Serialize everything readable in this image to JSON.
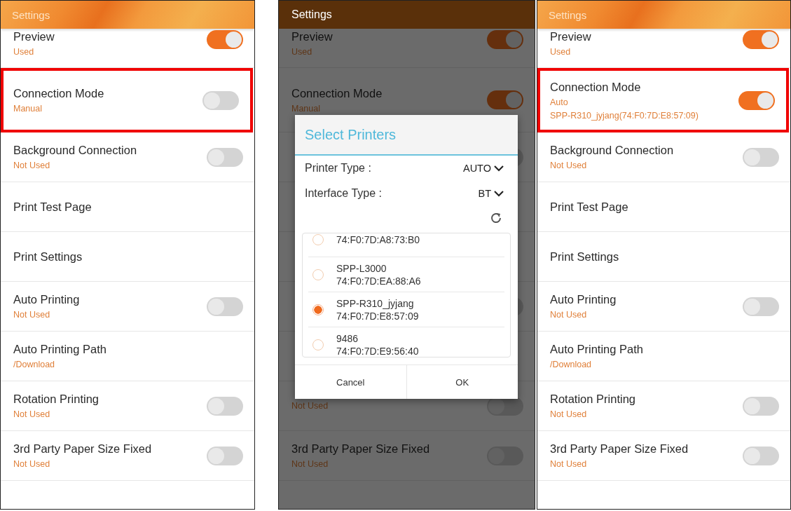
{
  "panels": [
    {
      "title": "Settings",
      "items": [
        {
          "title": "Preview",
          "subtitles": [
            "Used"
          ],
          "kind": "toggle",
          "on": true,
          "highlighted": false
        },
        {
          "title": "Connection Mode",
          "subtitles": [
            "Manual"
          ],
          "kind": "toggle",
          "on": false,
          "highlighted": true
        },
        {
          "title": "Background Connection",
          "subtitles": [
            "Not Used"
          ],
          "kind": "toggle",
          "on": false,
          "highlighted": false
        },
        {
          "title": "Print Test Page",
          "kind": "plain",
          "highlighted": false
        },
        {
          "title": "Print Settings",
          "kind": "plain",
          "highlighted": false
        },
        {
          "title": "Auto Printing",
          "subtitles": [
            "Not Used"
          ],
          "kind": "toggle",
          "on": false,
          "highlighted": false
        },
        {
          "title": "Auto Printing Path",
          "subtitles": [
            "/Download"
          ],
          "kind": "plain",
          "highlighted": false
        },
        {
          "title": "Rotation Printing",
          "subtitles": [
            "Not Used"
          ],
          "kind": "toggle",
          "on": false,
          "highlighted": false
        },
        {
          "title": "3rd Party Paper Size Fixed",
          "subtitles": [
            "Not Used"
          ],
          "kind": "toggle",
          "on": false,
          "highlighted": false
        }
      ]
    },
    {
      "title": "Settings",
      "items": [
        {
          "title": "Preview",
          "subtitles": [
            "Used"
          ],
          "kind": "toggle",
          "on": true,
          "highlighted": false
        },
        {
          "title": "Connection Mode",
          "subtitles": [
            "Manual"
          ],
          "kind": "toggle",
          "on": true,
          "highlighted": false
        },
        {
          "kind": "toggle",
          "on": false,
          "highlighted": false
        },
        {
          "kind": "plain",
          "highlighted": false
        },
        {
          "kind": "plain",
          "highlighted": false
        },
        {
          "kind": "toggle",
          "on": false,
          "highlighted": false
        },
        {
          "kind": "plain",
          "highlighted": false
        },
        {
          "subtitles": [
            "Not Used"
          ],
          "kind": "toggle",
          "on": false,
          "highlighted": false
        },
        {
          "title": "3rd Party Paper Size Fixed",
          "subtitles": [
            "Not Used"
          ],
          "kind": "toggle",
          "on": false,
          "highlighted": false
        }
      ],
      "dialog": {
        "title": "Select Printers",
        "fields": [
          {
            "label": "Printer Type :",
            "value": "AUTO"
          },
          {
            "label": "Interface Type :",
            "value": "BT"
          }
        ],
        "devices": [
          {
            "address": "74:F0:7D:A8:73:B0",
            "selected": false
          },
          {
            "name": "SPP-L3000",
            "address": "74:F0:7D:EA:88:A6",
            "selected": false
          },
          {
            "name": "SPP-R310_jyjang",
            "address": "74:F0:7D:E8:57:09",
            "selected": true
          },
          {
            "name": "9486",
            "address": "74:F0:7D:E9:56:40",
            "selected": false
          }
        ],
        "buttons": [
          "Cancel",
          "OK"
        ]
      }
    },
    {
      "title": "Settings",
      "items": [
        {
          "title": "Preview",
          "subtitles": [
            "Used"
          ],
          "kind": "toggle",
          "on": true,
          "highlighted": false
        },
        {
          "title": "Connection Mode",
          "subtitles": [
            "Auto",
            "SPP-R310_jyjang(74:F0:7D:E8:57:09)"
          ],
          "kind": "toggle",
          "on": true,
          "highlighted": true
        },
        {
          "title": "Background Connection",
          "subtitles": [
            "Not Used"
          ],
          "kind": "toggle",
          "on": false,
          "highlighted": false
        },
        {
          "title": "Print Test Page",
          "kind": "plain",
          "highlighted": false
        },
        {
          "title": "Print Settings",
          "kind": "plain",
          "highlighted": false
        },
        {
          "title": "Auto Printing",
          "subtitles": [
            "Not Used"
          ],
          "kind": "toggle",
          "on": false,
          "highlighted": false
        },
        {
          "title": "Auto Printing Path",
          "subtitles": [
            "/Download"
          ],
          "kind": "plain",
          "highlighted": false
        },
        {
          "title": "Rotation Printing",
          "subtitles": [
            "Not Used"
          ],
          "kind": "toggle",
          "on": false,
          "highlighted": false
        },
        {
          "title": "3rd Party Paper Size Fixed",
          "subtitles": [
            "Not Used"
          ],
          "kind": "toggle",
          "on": false,
          "highlighted": false
        }
      ]
    }
  ]
}
